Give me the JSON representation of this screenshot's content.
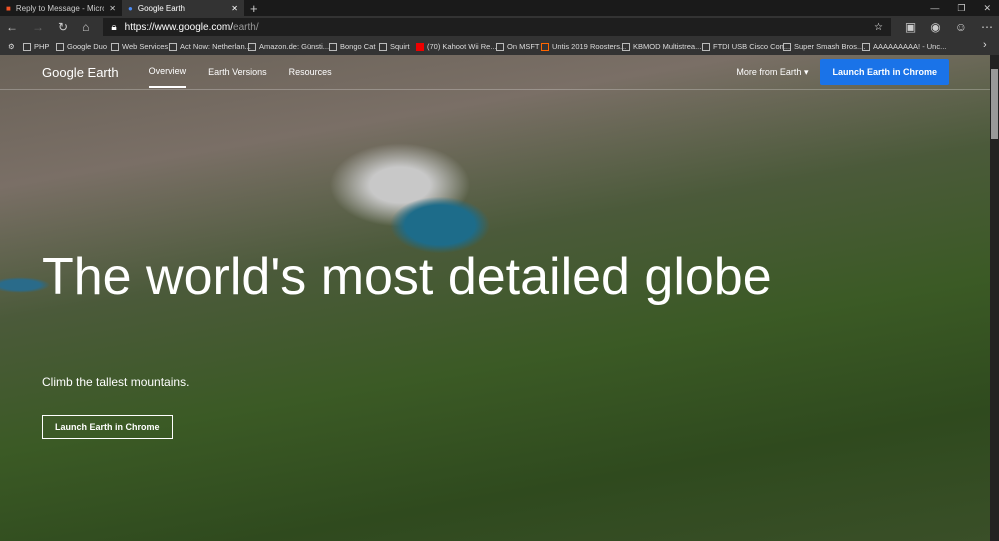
{
  "tabs": [
    {
      "title": "Reply to Message - Microsoft Te"
    },
    {
      "title": "Google Earth"
    }
  ],
  "url": {
    "host": "https://www.google.com/",
    "path": "earth/"
  },
  "bookmarks": [
    "PHP",
    "Google Duo",
    "Web Services",
    "Act Now: Netherlan...",
    "Amazon.de: Günsti...",
    "Bongo Cat",
    "Squirt",
    "(70) Kahoot Wii Re...",
    "On MSFT",
    "Untis 2019 Roosters...",
    "KBMOD Multistrea...",
    "FTDI USB Cisco Con...",
    "Super Smash Bros....",
    "AAAAAAAAA! - Unc..."
  ],
  "nav": {
    "logo": "Google Earth",
    "links": [
      "Overview",
      "Earth Versions",
      "Resources"
    ],
    "more": "More from Earth",
    "cta": "Launch Earth in Chrome"
  },
  "hero": {
    "title": "The world's most detailed globe",
    "subtitle": "Climb the tallest mountains.",
    "button": "Launch Earth in Chrome"
  }
}
